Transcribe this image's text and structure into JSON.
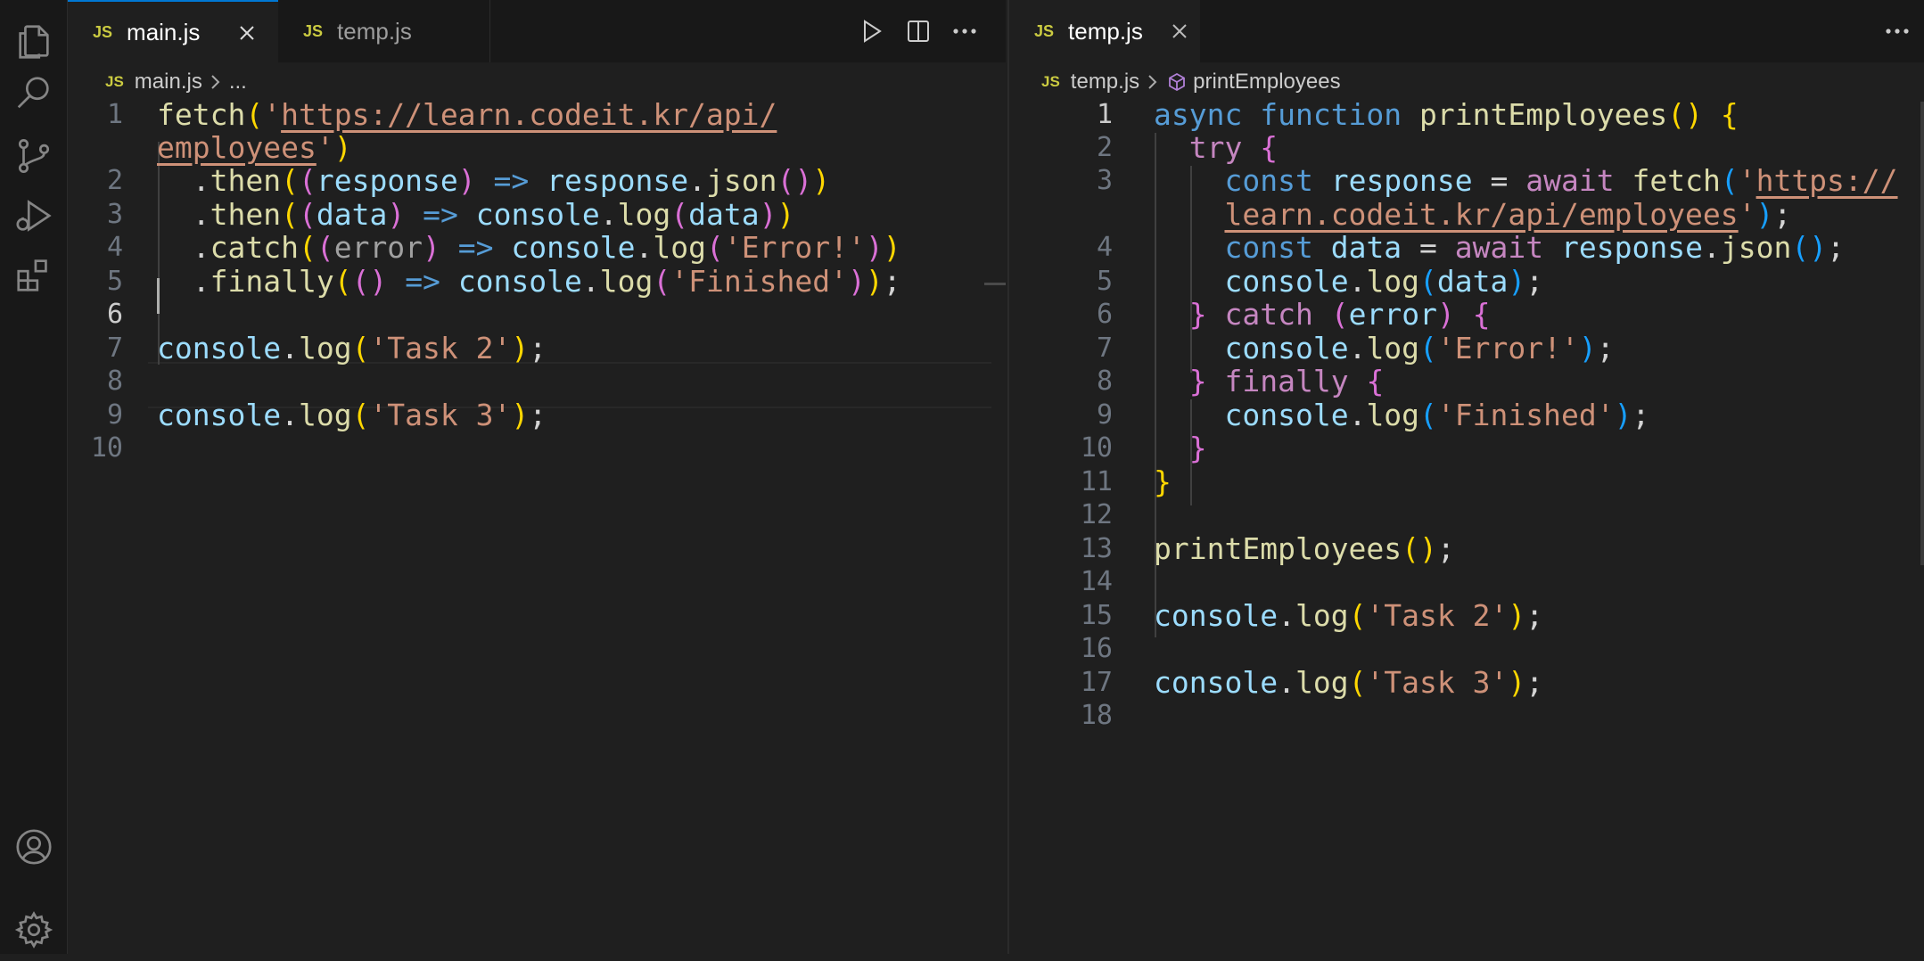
{
  "left_pane": {
    "tabs": [
      {
        "badge": "JS",
        "label": "main.js"
      },
      {
        "badge": "JS",
        "label": "temp.js"
      }
    ],
    "breadcrumb": {
      "badge": "JS",
      "file": "main.js",
      "more": "..."
    },
    "line_numbers": [
      "1",
      "2",
      "3",
      "4",
      "5",
      "6",
      "7",
      "8",
      "9",
      "10"
    ]
  },
  "right_pane": {
    "tabs": [
      {
        "badge": "JS",
        "label": "temp.js"
      }
    ],
    "breadcrumb": {
      "badge": "JS",
      "file": "temp.js",
      "symbol": "printEmployees"
    },
    "line_numbers": [
      "1",
      "2",
      "3",
      "4",
      "5",
      "6",
      "7",
      "8",
      "9",
      "10",
      "11",
      "12",
      "13",
      "14",
      "15",
      "16",
      "17",
      "18"
    ]
  },
  "icons": {
    "activity_bar": [
      "files-icon",
      "search-icon",
      "source-control-icon",
      "run-debug-icon",
      "extensions-icon",
      "account-icon",
      "settings-gear-icon"
    ],
    "editor_actions": [
      "run-icon",
      "split-editor-icon",
      "more-actions-icon"
    ]
  },
  "colors": {
    "keyword": "#569cd6",
    "control": "#c586c0",
    "function": "#dcdcaa",
    "variable": "#9cdcfe",
    "string": "#ce9178",
    "js_badge": "#cbcb41",
    "bracket_1": "#ffd700",
    "bracket_2": "#da70d6",
    "bracket_3": "#179fff"
  }
}
